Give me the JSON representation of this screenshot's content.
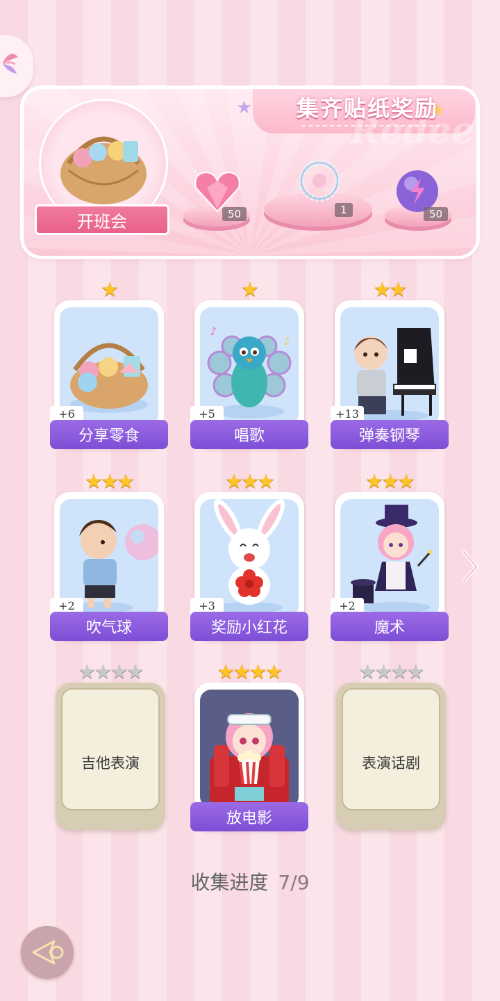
{
  "banner": {
    "title": "集齐贴纸奖励",
    "watermark": "Redeem",
    "event_label": "开班会",
    "rewards": [
      {
        "icon": "pink-heart-gem-icon",
        "count": "50"
      },
      {
        "icon": "pearl-bracelet-icon",
        "count": "1"
      },
      {
        "icon": "purple-orb-icon",
        "count": "50"
      }
    ]
  },
  "cards": [
    {
      "label": "分享零食",
      "bonus": "+6",
      "stars": 1,
      "unlocked": true,
      "icon": "snack-basket-icon"
    },
    {
      "label": "唱歌",
      "bonus": "+5",
      "stars": 1,
      "unlocked": true,
      "icon": "singing-peacock-icon"
    },
    {
      "label": "弹奏钢琴",
      "bonus": "+13",
      "stars": 2,
      "unlocked": true,
      "icon": "boy-piano-icon"
    },
    {
      "label": "吹气球",
      "bonus": "+2",
      "stars": 3,
      "unlocked": true,
      "icon": "boy-balloon-icon"
    },
    {
      "label": "奖励小红花",
      "bonus": "+3",
      "stars": 3,
      "unlocked": true,
      "icon": "bunny-flower-icon"
    },
    {
      "label": "魔术",
      "bonus": "+2",
      "stars": 3,
      "unlocked": true,
      "icon": "magician-girl-icon"
    },
    {
      "label": "吉他表演",
      "bonus": "",
      "stars": 4,
      "unlocked": false,
      "icon": ""
    },
    {
      "label": "放电影",
      "bonus": "",
      "stars": 4,
      "unlocked": true,
      "icon": "popcorn-girl-icon"
    },
    {
      "label": "表演话剧",
      "bonus": "",
      "stars": 4,
      "unlocked": false,
      "icon": ""
    }
  ],
  "progress": {
    "label": "收集进度",
    "value": "7/9"
  }
}
